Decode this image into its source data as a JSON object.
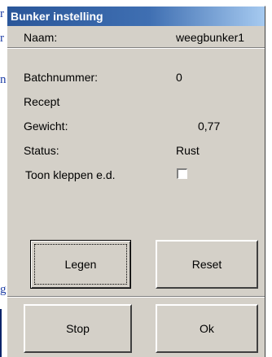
{
  "background_document": {
    "fragments": [
      "r",
      "r",
      "n.",
      "g"
    ]
  },
  "dialog": {
    "title": "Bunker instelling",
    "fields": {
      "naam": {
        "label": "Naam:",
        "value": "weegbunker1"
      },
      "batchnummer": {
        "label": "Batchnummer:",
        "value": "0"
      },
      "recept": {
        "label": "Recept",
        "value": ""
      },
      "gewicht": {
        "label": "Gewicht:",
        "value": "0,77"
      },
      "status": {
        "label": "Status:",
        "value": "Rust"
      },
      "toon_kleppen": {
        "label": "Toon kleppen e.d.",
        "checked": false
      }
    },
    "buttons": {
      "legen": "Legen",
      "reset": "Reset",
      "stop": "Stop",
      "ok": "Ok"
    },
    "colors": {
      "titlebar_start": "#2a5699",
      "titlebar_end": "#a6caf0",
      "face": "#d4d0c8"
    }
  }
}
